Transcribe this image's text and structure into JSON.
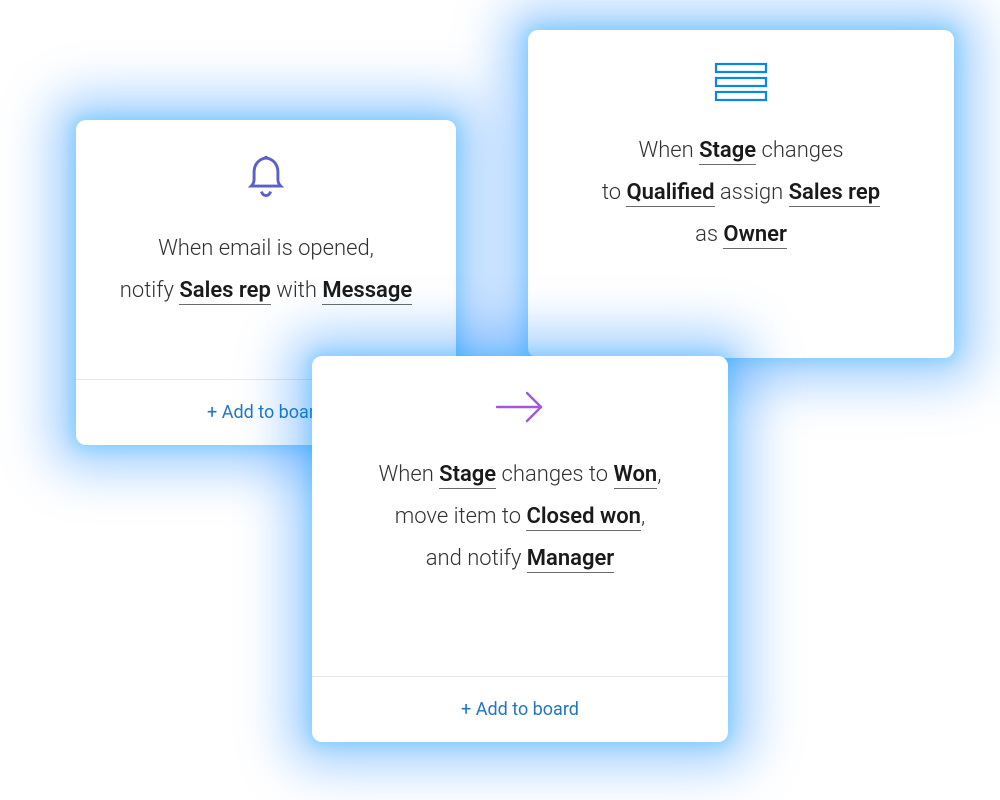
{
  "cards": {
    "notify": {
      "icon": "bell",
      "icon_color": "#5b5fc7",
      "text_prefix": "When email is opened,\nnotify ",
      "var1": "Sales rep",
      "text_mid": " with ",
      "var2": "Message",
      "add_label": "+ Add to board"
    },
    "assign": {
      "icon": "stack",
      "icon_color": "#0a85ea",
      "t1": "When ",
      "v1": "Stage",
      "t2": " changes",
      "t3": "to ",
      "v2": "Qualified",
      "t4": " assign ",
      "v3": "Sales rep",
      "t5": "as ",
      "v4": "Owner"
    },
    "move": {
      "icon": "arrow",
      "icon_color": "#a259d9",
      "t1": "When ",
      "v1": "Stage",
      "t2": " changes to ",
      "v2": "Won",
      "t3": ",",
      "t4": "move item to ",
      "v3": "Closed won",
      "t5": ",",
      "t6": "and notify ",
      "v4": "Manager",
      "add_label": "+ Add to board"
    }
  }
}
